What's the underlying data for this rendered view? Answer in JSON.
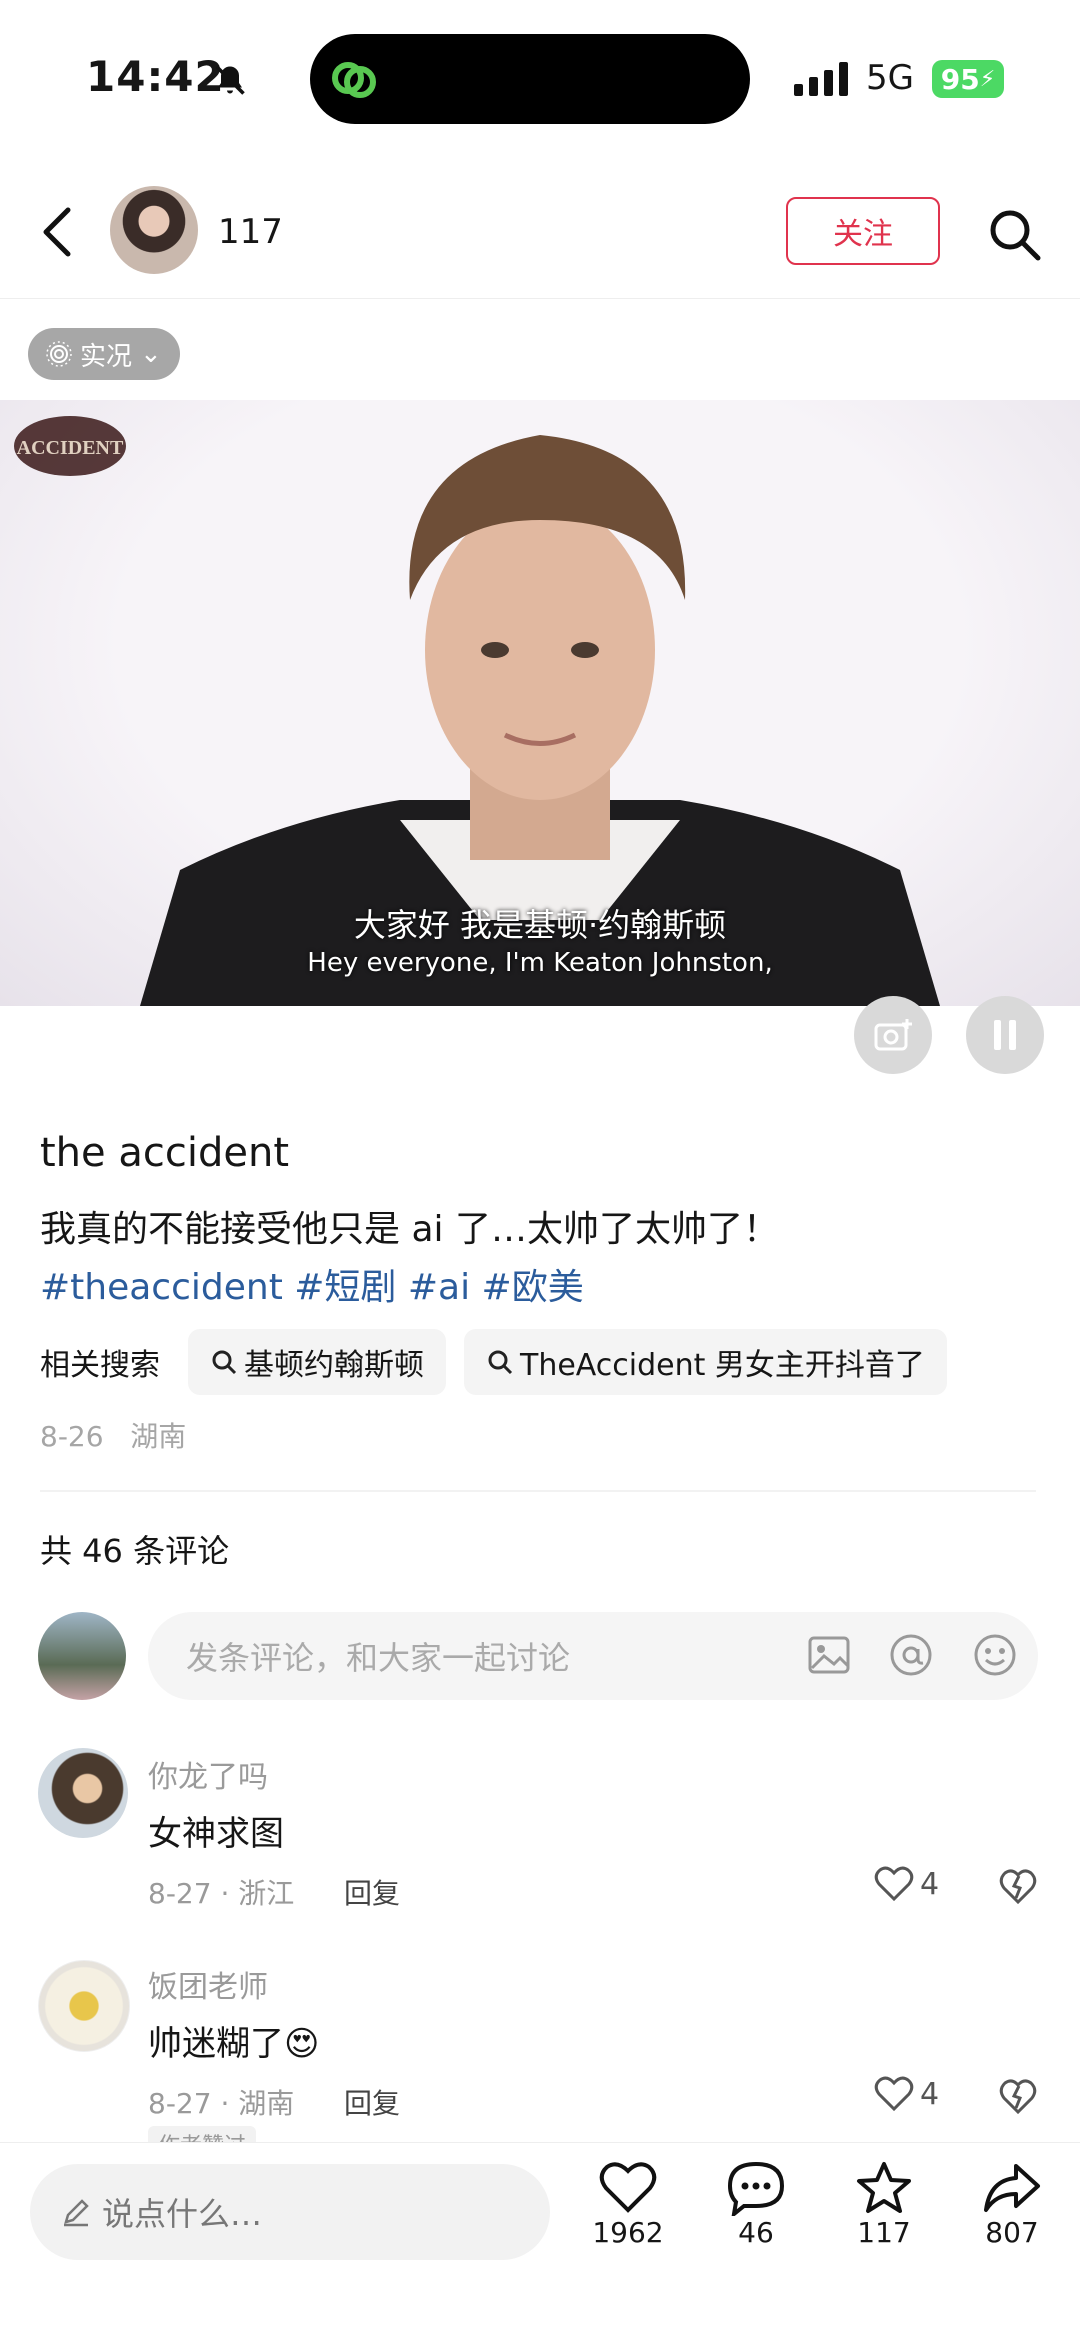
{
  "status_bar": {
    "time": "14:42",
    "network": "5G",
    "battery": "95"
  },
  "header": {
    "username": "117",
    "follow_label": "关注"
  },
  "live_badge": {
    "label": "实况"
  },
  "video": {
    "subtitle_cn": "大家好 我是基顿·约翰斯顿",
    "subtitle_en": "Hey everyone, I'm Keaton Johnston,",
    "logo_text": "THE ACCIDENT"
  },
  "post": {
    "title": "the accident",
    "description": "我真的不能接受他只是 ai 了…太帅了太帅了！",
    "tags": "#theaccident #短剧 #ai #欧美",
    "related_label": "相关搜索",
    "related": [
      "基顿约翰斯顿",
      "TheAccident 男女主开抖音了"
    ],
    "date": "8-26",
    "location": "湖南"
  },
  "comments": {
    "count_text": "共 46 条评论",
    "input_placeholder": "发条评论，和大家一起讨论",
    "items": [
      {
        "name": "你龙了吗",
        "text": "女神求图",
        "meta": "8-27 · 浙江",
        "reply": "回复",
        "likes": "4"
      },
      {
        "name": "饭团老师",
        "text": "帅迷糊了😍",
        "meta": "8-27 · 湖南",
        "reply": "回复",
        "likes": "4",
        "tag": "作者赞过"
      }
    ]
  },
  "bottom_bar": {
    "input_placeholder": "说点什么…",
    "likes": "1962",
    "comments": "46",
    "favorites": "117",
    "shares": "807"
  },
  "colors": {
    "accent": "#e0334d",
    "tag_blue": "#2b5c9c",
    "battery_green": "#4cd964"
  }
}
